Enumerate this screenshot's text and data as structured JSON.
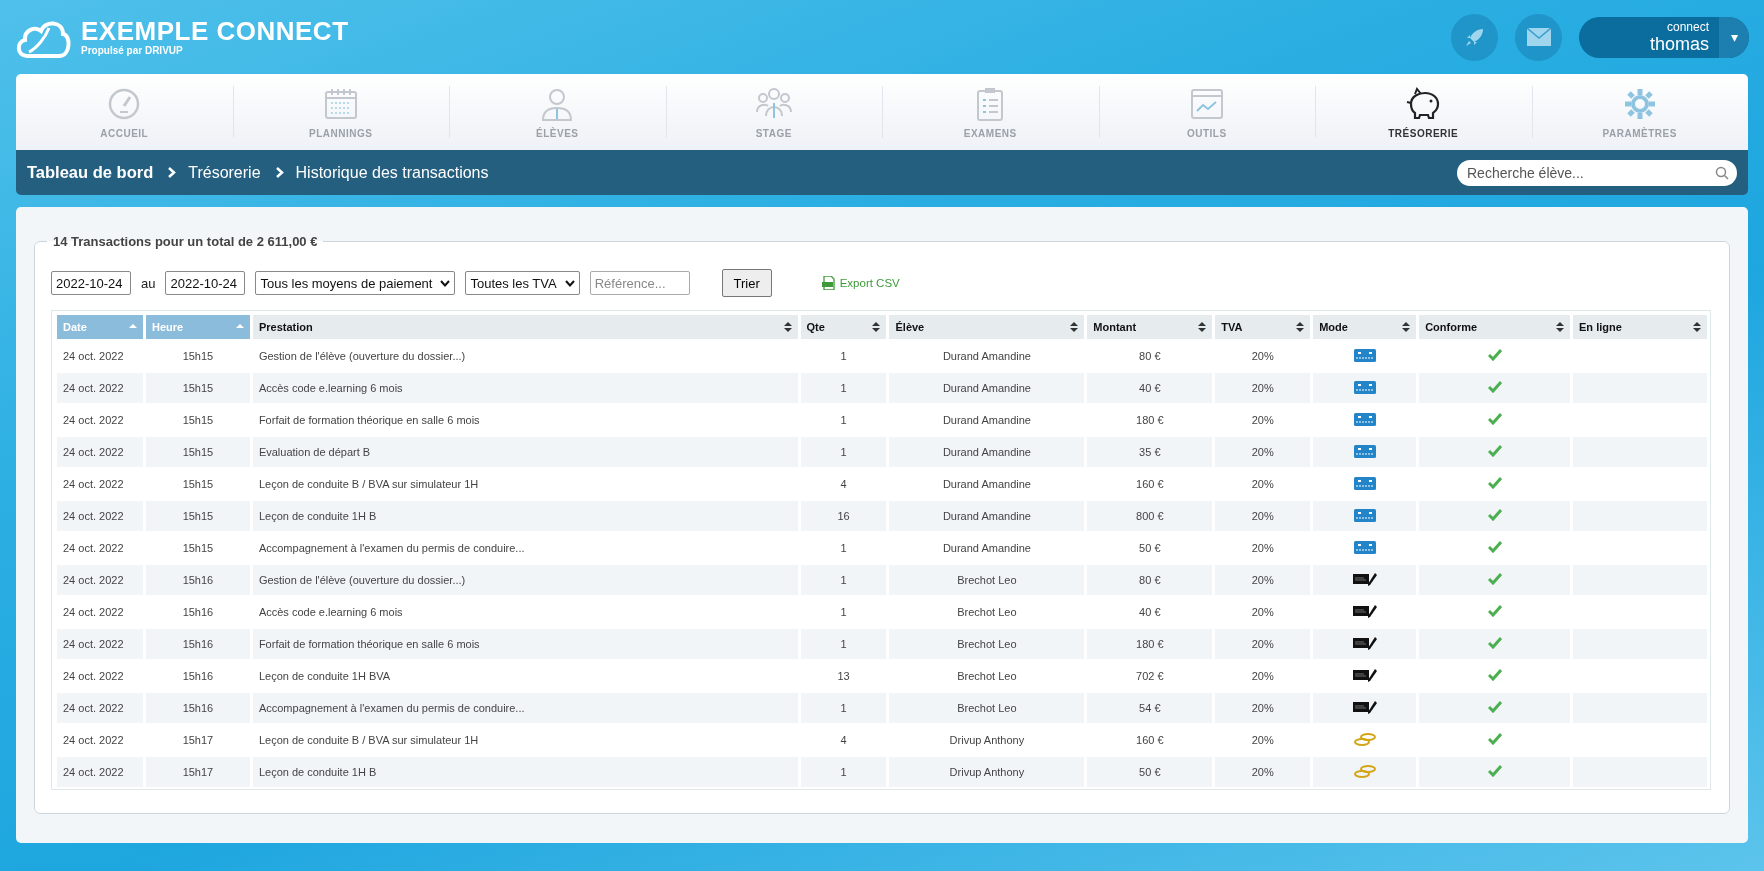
{
  "brand": {
    "title": "EXEMPLE CONNECT",
    "subtitle": "Propulsé par DRIVUP"
  },
  "user": {
    "caption": "connect",
    "name": "thomas",
    "caret": "▾"
  },
  "nav": [
    {
      "label": "ACCUEIL",
      "selected": false
    },
    {
      "label": "PLANNINGS",
      "selected": false
    },
    {
      "label": "ÉLÈVES",
      "selected": false
    },
    {
      "label": "STAGE",
      "selected": false
    },
    {
      "label": "EXAMENS",
      "selected": false
    },
    {
      "label": "OUTILS",
      "selected": false
    },
    {
      "label": "TRÉSORERIE",
      "selected": true
    },
    {
      "label": "PARAMÈTRES",
      "selected": false
    }
  ],
  "breadcrumb": [
    "Tableau de bord",
    "Trésorerie",
    "Historique des transactions"
  ],
  "search": {
    "placeholder": "Recherche élève..."
  },
  "panel": {
    "legend": "14 Transactions pour un total de 2 611,00 €"
  },
  "filters": {
    "date_from": "2022-10-24",
    "between": "au",
    "date_to": "2022-10-24",
    "payment": "Tous les moyens de paiement",
    "vat": "Toutes les TVA",
    "reference_placeholder": "Référence...",
    "sort_button": "Trier",
    "export": "Export CSV"
  },
  "table": {
    "columns": [
      {
        "label": "Date",
        "sorted": true
      },
      {
        "label": "Heure",
        "sorted": true
      },
      {
        "label": "Prestation",
        "sorted": false
      },
      {
        "label": "Qte",
        "sorted": false
      },
      {
        "label": "Élève",
        "sorted": false
      },
      {
        "label": "Montant",
        "sorted": false
      },
      {
        "label": "TVA",
        "sorted": false
      },
      {
        "label": "Mode",
        "sorted": false
      },
      {
        "label": "Conforme",
        "sorted": false
      },
      {
        "label": "En ligne",
        "sorted": false
      }
    ],
    "rows": [
      {
        "date": "24 oct. 2022",
        "time": "15h15",
        "service": "Gestion de l'élève (ouverture du dossier...)",
        "qty": "1",
        "student": "Durand Amandine",
        "amount": "80 €",
        "vat": "20%",
        "kind": "card",
        "compliant": true
      },
      {
        "date": "24 oct. 2022",
        "time": "15h15",
        "service": "Accès code e.learning 6 mois",
        "qty": "1",
        "student": "Durand Amandine",
        "amount": "40 €",
        "vat": "20%",
        "kind": "card",
        "compliant": true
      },
      {
        "date": "24 oct. 2022",
        "time": "15h15",
        "service": "Forfait de formation théorique en salle 6 mois",
        "qty": "1",
        "student": "Durand Amandine",
        "amount": "180 €",
        "vat": "20%",
        "kind": "card",
        "compliant": true
      },
      {
        "date": "24 oct. 2022",
        "time": "15h15",
        "service": "Evaluation de départ B",
        "qty": "1",
        "student": "Durand Amandine",
        "amount": "35 €",
        "vat": "20%",
        "kind": "card",
        "compliant": true
      },
      {
        "date": "24 oct. 2022",
        "time": "15h15",
        "service": "Leçon de conduite B / BVA sur simulateur 1H",
        "qty": "4",
        "student": "Durand Amandine",
        "amount": "160 €",
        "vat": "20%",
        "kind": "card",
        "compliant": true
      },
      {
        "date": "24 oct. 2022",
        "time": "15h15",
        "service": "Leçon de conduite 1H B",
        "qty": "16",
        "student": "Durand Amandine",
        "amount": "800 €",
        "vat": "20%",
        "kind": "card",
        "compliant": true
      },
      {
        "date": "24 oct. 2022",
        "time": "15h15",
        "service": "Accompagnement à l'examen du permis de conduire...",
        "qty": "1",
        "student": "Durand Amandine",
        "amount": "50 €",
        "vat": "20%",
        "kind": "card",
        "compliant": true
      },
      {
        "date": "24 oct. 2022",
        "time": "15h16",
        "service": "Gestion de l'élève (ouverture du dossier...)",
        "qty": "1",
        "student": "Brechot Leo",
        "amount": "80 €",
        "vat": "20%",
        "kind": "cheque",
        "compliant": true
      },
      {
        "date": "24 oct. 2022",
        "time": "15h16",
        "service": "Accès code e.learning 6 mois",
        "qty": "1",
        "student": "Brechot Leo",
        "amount": "40 €",
        "vat": "20%",
        "kind": "cheque",
        "compliant": true
      },
      {
        "date": "24 oct. 2022",
        "time": "15h16",
        "service": "Forfait de formation théorique en salle 6 mois",
        "qty": "1",
        "student": "Brechot Leo",
        "amount": "180 €",
        "vat": "20%",
        "kind": "cheque",
        "compliant": true
      },
      {
        "date": "24 oct. 2022",
        "time": "15h16",
        "service": "Leçon de conduite 1H BVA",
        "qty": "13",
        "student": "Brechot Leo",
        "amount": "702 €",
        "vat": "20%",
        "kind": "cheque",
        "compliant": true
      },
      {
        "date": "24 oct. 2022",
        "time": "15h16",
        "service": "Accompagnement à l'examen du permis de conduire...",
        "qty": "1",
        "student": "Brechot Leo",
        "amount": "54 €",
        "vat": "20%",
        "kind": "cheque",
        "compliant": true
      },
      {
        "date": "24 oct. 2022",
        "time": "15h17",
        "service": "Leçon de conduite B / BVA sur simulateur 1H",
        "qty": "4",
        "student": "Drivup Anthony",
        "amount": "160 €",
        "vat": "20%",
        "kind": "cash",
        "compliant": true
      },
      {
        "date": "24 oct. 2022",
        "time": "15h17",
        "service": "Leçon de conduite 1H B",
        "qty": "1",
        "student": "Drivup Anthony",
        "amount": "50 €",
        "vat": "20%",
        "kind": "cash",
        "compliant": true
      }
    ]
  }
}
